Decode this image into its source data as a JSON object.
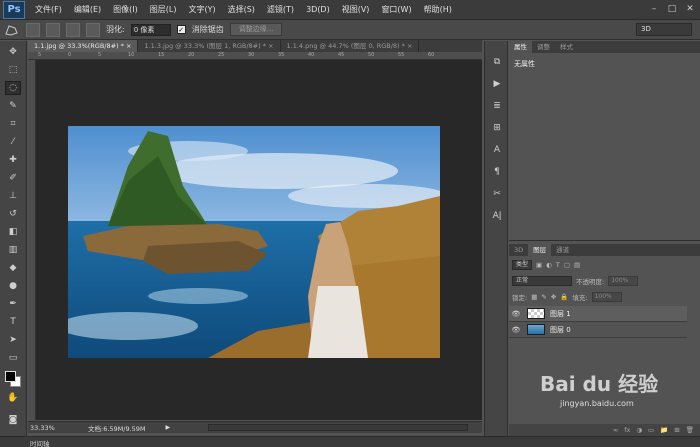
{
  "app": {
    "logo": "Ps"
  },
  "menu": [
    "文件(F)",
    "编辑(E)",
    "图像(I)",
    "图层(L)",
    "文字(Y)",
    "选择(S)",
    "滤镜(T)",
    "3D(D)",
    "视图(V)",
    "窗口(W)",
    "帮助(H)"
  ],
  "window_controls": {
    "minimize": "–",
    "restore": "□",
    "close": "✕"
  },
  "options": {
    "feather_label": "羽化:",
    "feather_value": "0 像素",
    "antialias_label": "消除锯齿",
    "antialias_check": "✓",
    "refine_edge": "调整边缘...",
    "workspace": "3D"
  },
  "tabs": [
    {
      "label": "1.1.jpg @ 33.3%(RGB/8#) *",
      "close": "×"
    },
    {
      "label": "1.1.3.jpg @ 33.3% (图层 1, RGB/8#) *",
      "close": "×"
    },
    {
      "label": "1.1.4.png @ 44.7% (图层 0, RGB/8) *",
      "close": "×"
    }
  ],
  "ruler_ticks": [
    "5",
    "0",
    "5",
    "10",
    "15",
    "20",
    "25",
    "30",
    "35",
    "40",
    "45",
    "50",
    "55",
    "60"
  ],
  "status": {
    "zoom": "33.33%",
    "doc_info": "文档:6.59M/9.59M",
    "arrow": "▶"
  },
  "timeline_label": "时间轴",
  "properties": {
    "tabs": [
      "属性",
      "调整",
      "样式"
    ],
    "no_properties": "无属性"
  },
  "layers": {
    "tabs": [
      "3D",
      "图层",
      "通道"
    ],
    "filter": "类型",
    "blend_mode": "正常",
    "opacity_label": "不透明度:",
    "opacity_value": "100%",
    "lock_label": "锁定:",
    "fill_label": "填充:",
    "fill_value": "100%",
    "items": [
      {
        "name": "图层 1",
        "visible": "👁"
      },
      {
        "name": "图层 0",
        "visible": "👁"
      }
    ],
    "footer": [
      "∞",
      "fx",
      "◑",
      "▭",
      "📁",
      "⊞",
      "🗑"
    ]
  },
  "watermark": {
    "logo": "Bai du 经验",
    "url": "jingyan.baidu.com"
  }
}
